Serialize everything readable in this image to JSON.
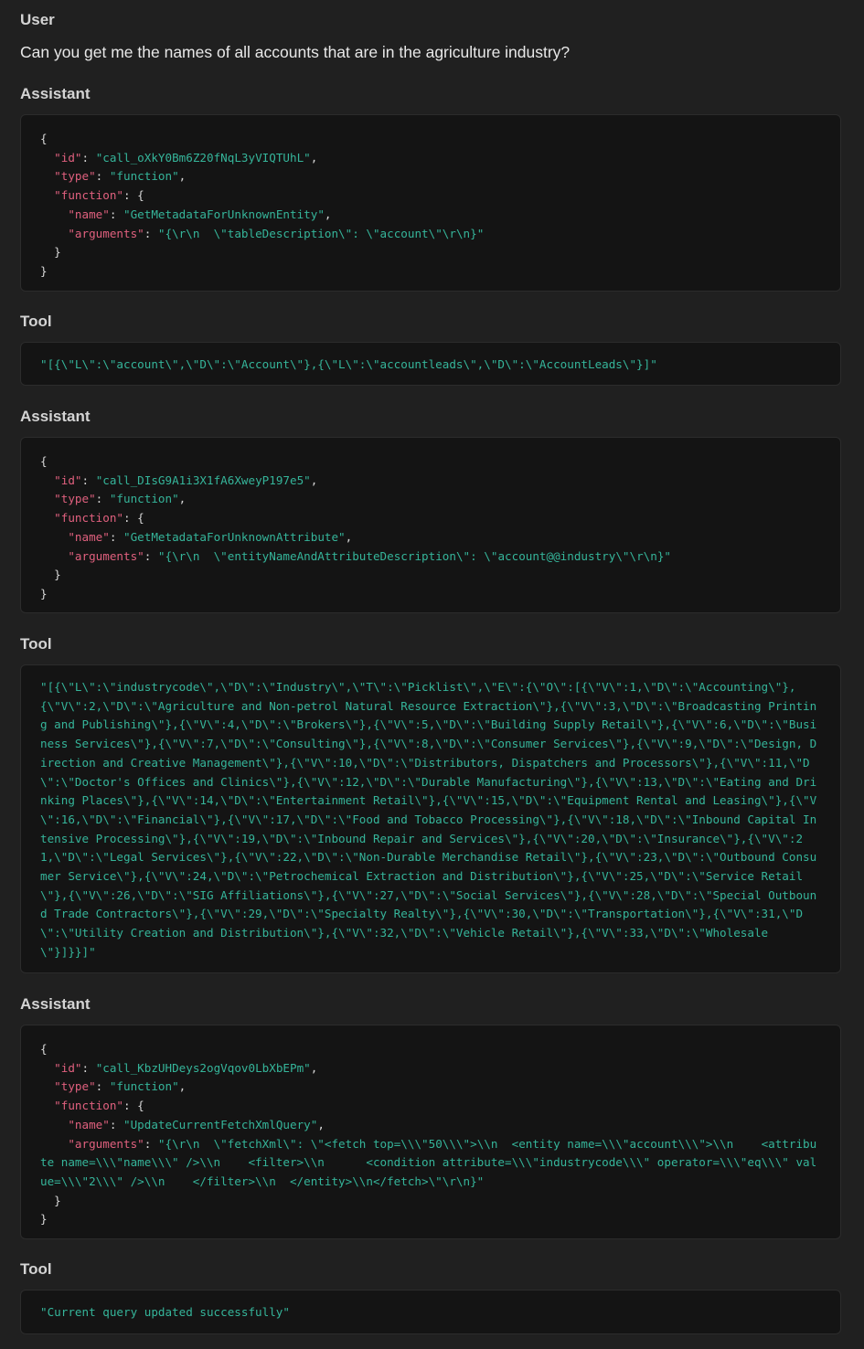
{
  "messages": [
    {
      "role": "User",
      "text": "Can you get me the names of all accounts that are in the agriculture industry?"
    },
    {
      "role": "Assistant",
      "call": {
        "id_key": "\"id\"",
        "id_value": "\"call_oXkY0Bm6Z20fNqL3yVIQTUhL\"",
        "type_key": "\"type\"",
        "type_value": "\"function\"",
        "function_key": "\"function\"",
        "name_key": "\"name\"",
        "name_value": "\"GetMetadataForUnknownEntity\"",
        "arguments_key": "\"arguments\"",
        "arguments_value": "\"{\\r\\n  \\\"tableDescription\\\": \\\"account\\\"\\r\\n}\""
      }
    },
    {
      "role": "Tool",
      "output": "\"[{\\\"L\\\":\\\"account\\\",\\\"D\\\":\\\"Account\\\"},{\\\"L\\\":\\\"accountleads\\\",\\\"D\\\":\\\"AccountLeads\\\"}]\""
    },
    {
      "role": "Assistant",
      "call": {
        "id_key": "\"id\"",
        "id_value": "\"call_DIsG9A1i3X1fA6XweyP197e5\"",
        "type_key": "\"type\"",
        "type_value": "\"function\"",
        "function_key": "\"function\"",
        "name_key": "\"name\"",
        "name_value": "\"GetMetadataForUnknownAttribute\"",
        "arguments_key": "\"arguments\"",
        "arguments_value": "\"{\\r\\n  \\\"entityNameAndAttributeDescription\\\": \\\"account@@industry\\\"\\r\\n}\""
      }
    },
    {
      "role": "Tool",
      "output": "\"[{\\\"L\\\":\\\"industrycode\\\",\\\"D\\\":\\\"Industry\\\",\\\"T\\\":\\\"Picklist\\\",\\\"E\\\":{\\\"O\\\":[{\\\"V\\\":1,\\\"D\\\":\\\"Accounting\\\"},{\\\"V\\\":2,\\\"D\\\":\\\"Agriculture and Non-petrol Natural Resource Extraction\\\"},{\\\"V\\\":3,\\\"D\\\":\\\"Broadcasting Printing and Publishing\\\"},{\\\"V\\\":4,\\\"D\\\":\\\"Brokers\\\"},{\\\"V\\\":5,\\\"D\\\":\\\"Building Supply Retail\\\"},{\\\"V\\\":6,\\\"D\\\":\\\"Business Services\\\"},{\\\"V\\\":7,\\\"D\\\":\\\"Consulting\\\"},{\\\"V\\\":8,\\\"D\\\":\\\"Consumer Services\\\"},{\\\"V\\\":9,\\\"D\\\":\\\"Design, Direction and Creative Management\\\"},{\\\"V\\\":10,\\\"D\\\":\\\"Distributors, Dispatchers and Processors\\\"},{\\\"V\\\":11,\\\"D\\\":\\\"Doctor's Offices and Clinics\\\"},{\\\"V\\\":12,\\\"D\\\":\\\"Durable Manufacturing\\\"},{\\\"V\\\":13,\\\"D\\\":\\\"Eating and Drinking Places\\\"},{\\\"V\\\":14,\\\"D\\\":\\\"Entertainment Retail\\\"},{\\\"V\\\":15,\\\"D\\\":\\\"Equipment Rental and Leasing\\\"},{\\\"V\\\":16,\\\"D\\\":\\\"Financial\\\"},{\\\"V\\\":17,\\\"D\\\":\\\"Food and Tobacco Processing\\\"},{\\\"V\\\":18,\\\"D\\\":\\\"Inbound Capital Intensive Processing\\\"},{\\\"V\\\":19,\\\"D\\\":\\\"Inbound Repair and Services\\\"},{\\\"V\\\":20,\\\"D\\\":\\\"Insurance\\\"},{\\\"V\\\":21,\\\"D\\\":\\\"Legal Services\\\"},{\\\"V\\\":22,\\\"D\\\":\\\"Non-Durable Merchandise Retail\\\"},{\\\"V\\\":23,\\\"D\\\":\\\"Outbound Consumer Service\\\"},{\\\"V\\\":24,\\\"D\\\":\\\"Petrochemical Extraction and Distribution\\\"},{\\\"V\\\":25,\\\"D\\\":\\\"Service Retail\\\"},{\\\"V\\\":26,\\\"D\\\":\\\"SIG Affiliations\\\"},{\\\"V\\\":27,\\\"D\\\":\\\"Social Services\\\"},{\\\"V\\\":28,\\\"D\\\":\\\"Special Outbound Trade Contractors\\\"},{\\\"V\\\":29,\\\"D\\\":\\\"Specialty Realty\\\"},{\\\"V\\\":30,\\\"D\\\":\\\"Transportation\\\"},{\\\"V\\\":31,\\\"D\\\":\\\"Utility Creation and Distribution\\\"},{\\\"V\\\":32,\\\"D\\\":\\\"Vehicle Retail\\\"},{\\\"V\\\":33,\\\"D\\\":\\\"Wholesale\\\"}]}}]\""
    },
    {
      "role": "Assistant",
      "call": {
        "id_key": "\"id\"",
        "id_value": "\"call_KbzUHDeys2ogVqov0LbXbEPm\"",
        "type_key": "\"type\"",
        "type_value": "\"function\"",
        "function_key": "\"function\"",
        "name_key": "\"name\"",
        "name_value": "\"UpdateCurrentFetchXmlQuery\"",
        "arguments_key": "\"arguments\"",
        "arguments_value": "\"{\\r\\n  \\\"fetchXml\\\": \\\"<fetch top=\\\\\\\"50\\\\\\\">\\\\n  <entity name=\\\\\\\"account\\\\\\\">\\\\n    <attribute name=\\\\\\\"name\\\\\\\" />\\\\n    <filter>\\\\n      <condition attribute=\\\\\\\"industrycode\\\\\\\" operator=\\\\\\\"eq\\\\\\\" value=\\\\\\\"2\\\\\\\" />\\\\n    </filter>\\\\n  </entity>\\\\n</fetch>\\\"\\r\\n}\""
      }
    },
    {
      "role": "Tool",
      "output": "\"Current query updated successfully\""
    }
  ],
  "colors": {
    "background": "#202020",
    "code_background": "#141414",
    "json_key": "#e0607e",
    "json_string": "#35b59a"
  }
}
